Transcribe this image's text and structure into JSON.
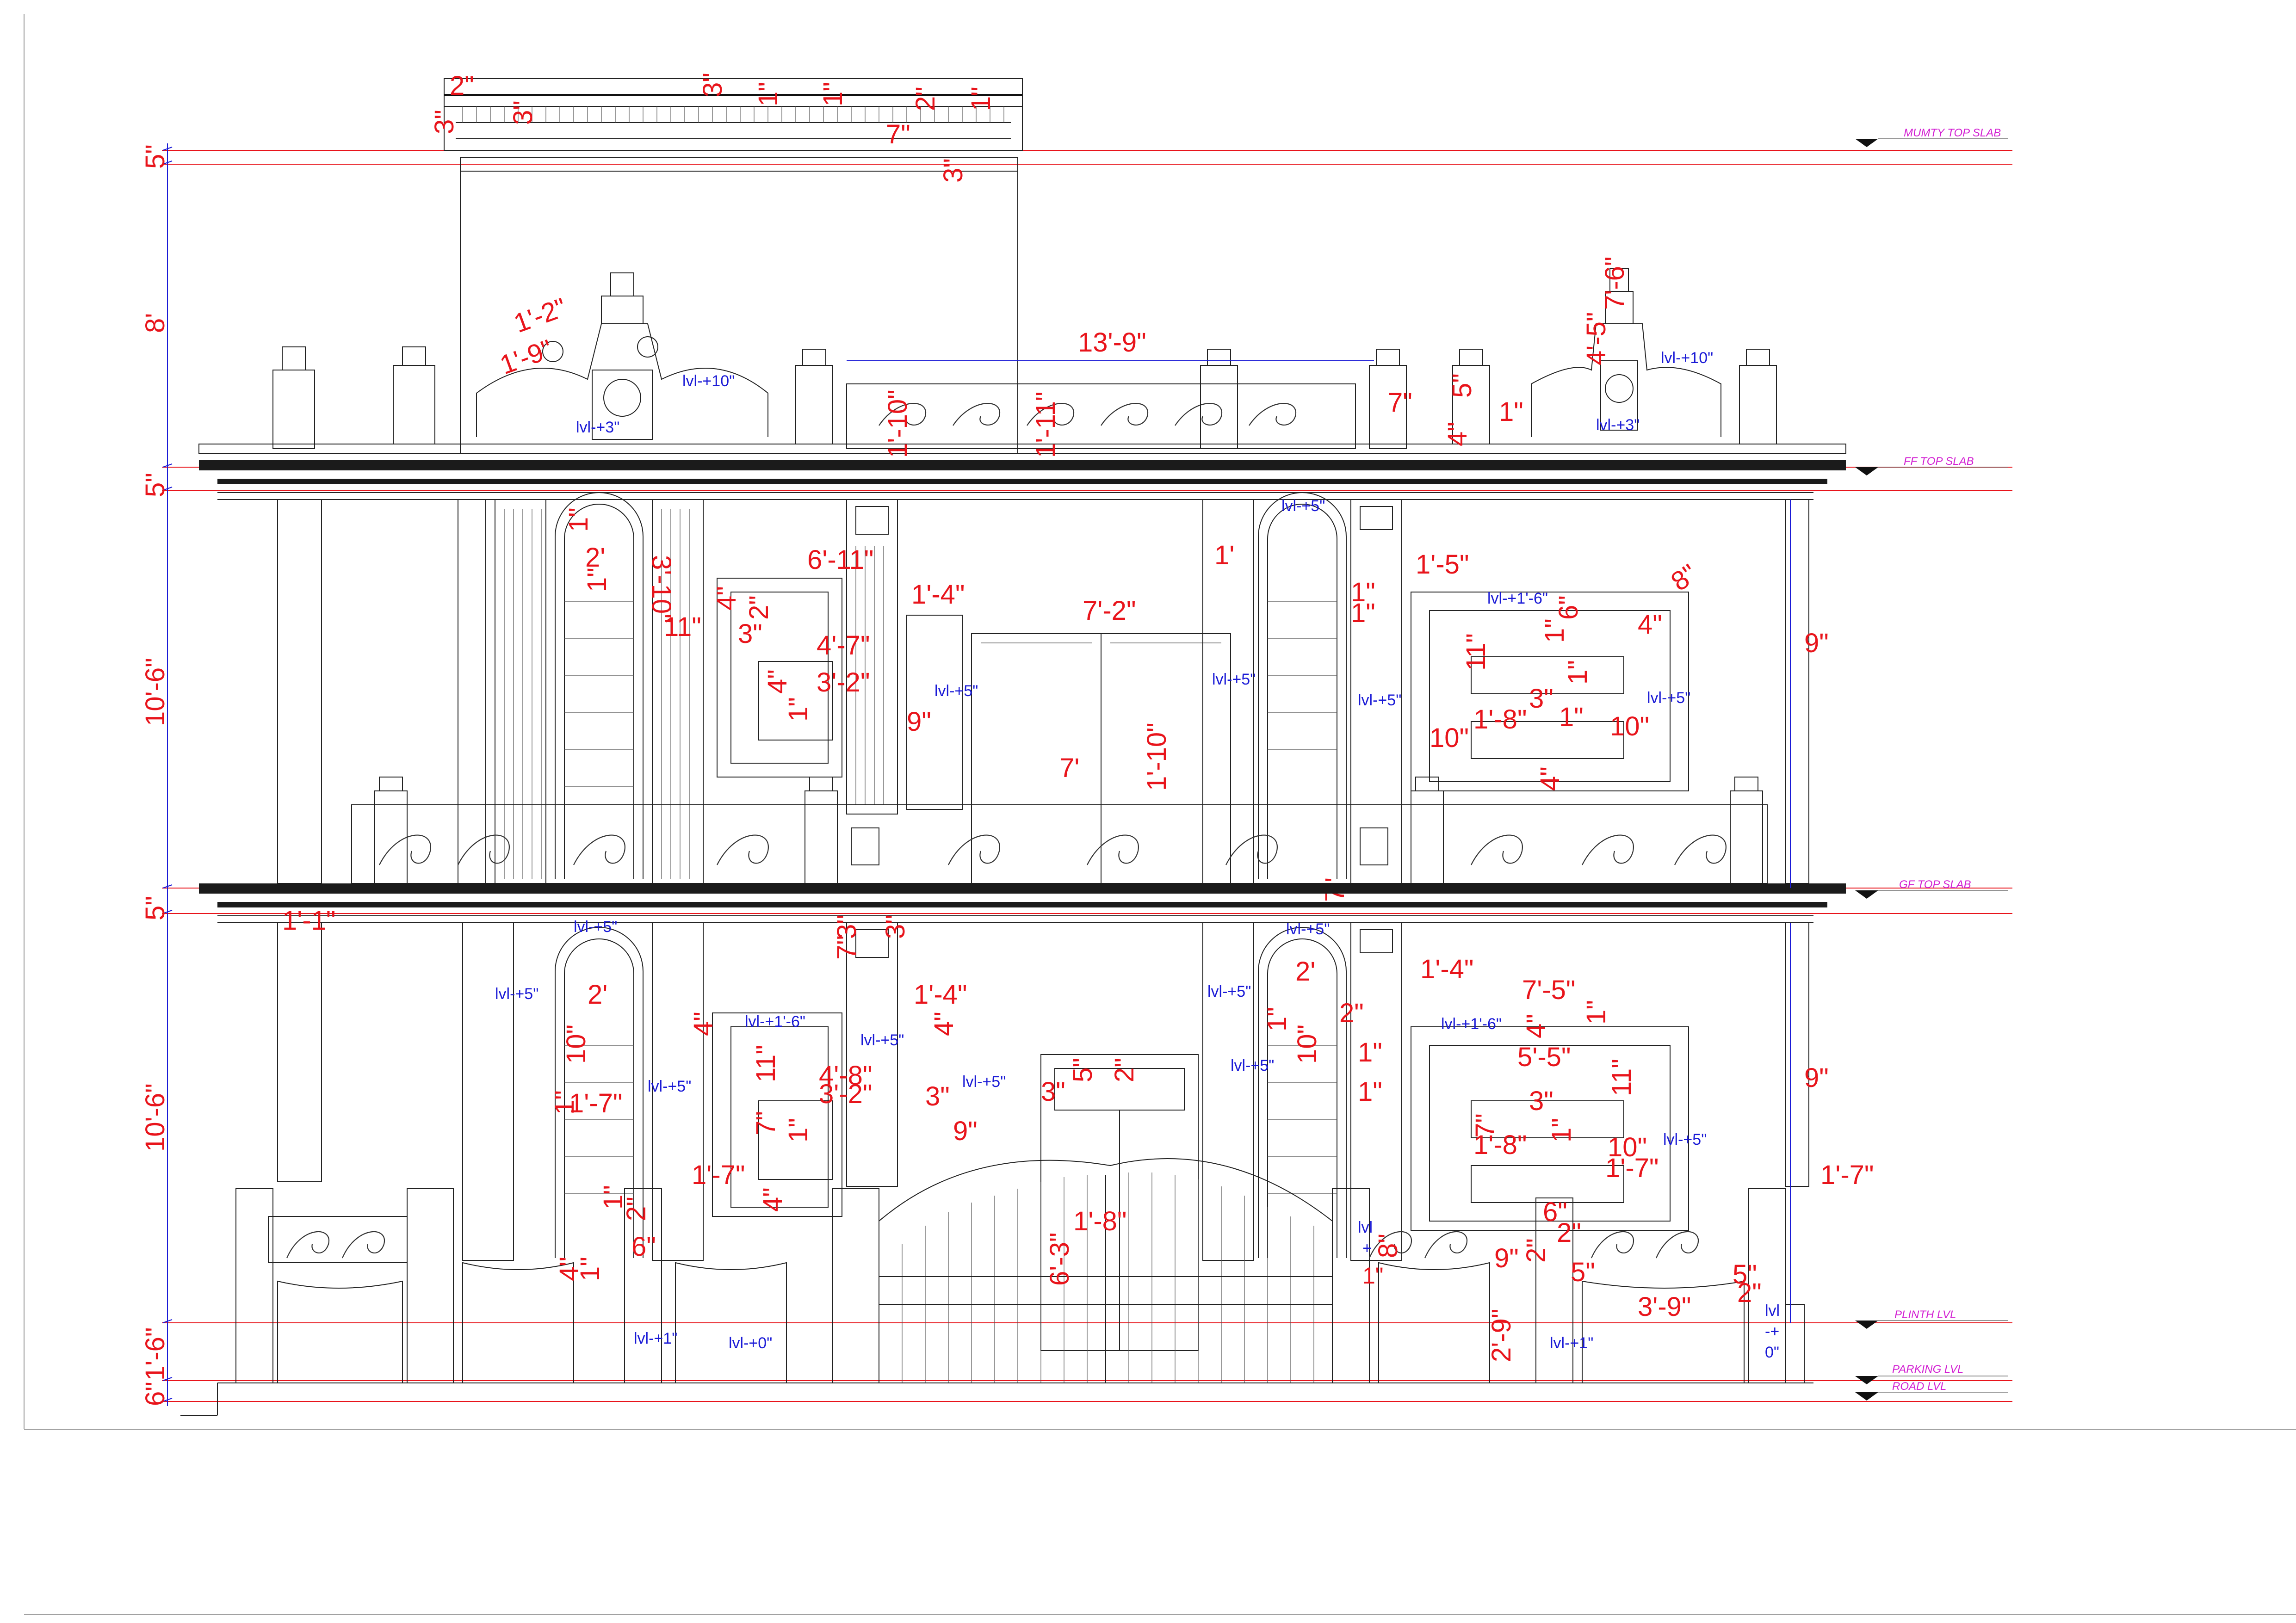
{
  "levels": {
    "mumty_top_slab": "MUMTY TOP SLAB",
    "ff_top_slab": "FF TOP SLAB",
    "gf_top_slab": "GF TOP SLAB",
    "plinth_lvl": "PLINTH LVL",
    "parking_lvl": "PARKING LVL",
    "road_lvl": "ROAD LVL"
  },
  "left_dims": {
    "mumty_slab": "5\"",
    "mumty_height": "8'",
    "ff_slab": "5\"",
    "ff_height": "10'-6\"",
    "gf_slab": "5\"",
    "gf_height": "10'-6\"",
    "plinth": "1'-6\"",
    "road": "6\""
  },
  "mumty_dims": [
    "2\"",
    "3\"",
    "3\"",
    "3\"",
    "1\"",
    "1\"",
    "2\"",
    "1\"",
    "7\"",
    "3\""
  ],
  "parapet_dims": {
    "span": "13'-9\"",
    "left_a": "1'-9\"",
    "left_b": "1'-2\"",
    "rail_a": "1'-10\"",
    "rail_b": "1'-11\"",
    "right_a": "7\"",
    "right_b": "5\"",
    "right_c": "4\"",
    "right_d": "4'-5\"",
    "right_e": "7'-6\"",
    "right_f": "1\""
  },
  "parapet_levels": {
    "left_upper": "lvl-+10\"",
    "left_lower": "lvl-+3\"",
    "right_upper": "lvl-+10\"",
    "right_lower": "lvl-+3\""
  },
  "ff_dims": {
    "arch_w": "2'",
    "arch_a": "1\"",
    "arch_r": "3'-10\"",
    "arch_b": "11\"",
    "win_w": "6'-11\"",
    "win_a": "1'-4\"",
    "win_b": "4\"",
    "win_c": "2\"",
    "win_d": "3\"",
    "win_e": "4'-7\"",
    "win_f": "3'-2\"",
    "win_g": "4\"",
    "win_h": "1\"",
    "win_i": "9\"",
    "door_w": "7'-2\"",
    "door_h": "7'",
    "door_b": "1'-10\"",
    "right_arch_a": "1'",
    "right_arch_b": "1'-5\"",
    "right_arch_c": "1\"",
    "right_arch_d": "1\"",
    "right_win_a": "11\"",
    "right_win_b": "1\"",
    "right_win_c": "1\"",
    "right_win_d": "3\"",
    "right_win_e": "1'-8\"",
    "right_win_f": "10\"",
    "right_win_g": "10\"",
    "right_win_h": "4\"",
    "right_win_i": "6\"",
    "right_win_j": "4\"",
    "right_win_k": "8\"",
    "right_win_l": "1\"",
    "right_cornice": "9\"",
    "bottom": "7\""
  },
  "ff_levels": {
    "top": "lvl-+5\"",
    "win_top": "lvl-+1'-6\"",
    "win_left": "lvl-+5\"",
    "center": "lvl-+5\"",
    "arch_right": "lvl-+5\"",
    "right": "lvl-+5\""
  },
  "gf_dims": {
    "pier": "1'-1\"",
    "arch_w": "2'",
    "arch_a": "10\"",
    "arch_b": "1'-7\"",
    "arch_c": "1\"",
    "top_a": "3\"",
    "top_b": "7\"",
    "top_c": "3\"",
    "win_a": "1'-4\"",
    "win_b": "4\"",
    "win_c": "4\"",
    "win_d": "11\"",
    "win_e": "4'-8\"",
    "win_f": "3'-2\"",
    "win_g": "3\"",
    "win_h": "7\"",
    "win_i": "1\"",
    "win_j": "9\"",
    "win_k": "4\"",
    "door_a": "5\"",
    "door_b": "2\"",
    "door_c": "3\"",
    "gate_a": "1'-8\"",
    "gate_b": "6'-3\"",
    "wall_a": "1'-7\"",
    "wall_b": "1\"",
    "wall_c": "2\"",
    "wall_d": "4\"",
    "wall_e": "1\"",
    "wall_f": "6\"",
    "right_arch_a": "2'",
    "right_arch_b": "10\"",
    "right_arch_c": "1\"",
    "right_arch_d": "2\"",
    "right_arch_e": "1\"",
    "right_arch_f": "1\"",
    "right_top_a": "1'-4\"",
    "right_top_b": "7'-5\"",
    "right_top_c": "4\"",
    "right_top_d": "1\"",
    "right_win_w": "5'-5\"",
    "right_win_a": "11\"",
    "right_win_b": "3\"",
    "right_win_c": "7\"",
    "right_win_d": "1\"",
    "right_win_e": "1'-8\"",
    "right_win_f": "10\"",
    "right_win_g": "1'-7\"",
    "right_cornice": "9\"",
    "right_pier": "1'-7\"",
    "bwall_a": "6\"",
    "bwall_b": "2\"",
    "bwall_c": "8\"",
    "bwall_d": "9\"",
    "bwall_e": "2\"",
    "bwall_f": "5\"",
    "bwall_g": "3'-9\"",
    "bwall_h": "5\"",
    "bwall_i": "2\"",
    "bwall_j": "2'-9\"",
    "bwall_k": "1\""
  },
  "gf_levels": {
    "top": "lvl-+5\"",
    "arch_left": "lvl-+5\"",
    "win_top": "lvl-+1'-6\"",
    "win_a": "lvl-+5\"",
    "win_b": "lvl-+5\"",
    "win_c": "lvl-+5\"",
    "arch_right_top": "lvl-+5\"",
    "arch_right_a": "lvl-+5\"",
    "arch_right_b": "lvl-+5\"",
    "right_top": "lvl-+1'-6\"",
    "right": "lvl-+5\"",
    "plinth_a": "lvl-+1\"",
    "plinth_b": "lvl-+0\"",
    "plinth_c": "lvl-+1\"",
    "gate_side": "lvl",
    "gate_side_b": "+",
    "right_side_a": "lvl",
    "right_side_b": "-+",
    "right_side_c": "0\""
  }
}
